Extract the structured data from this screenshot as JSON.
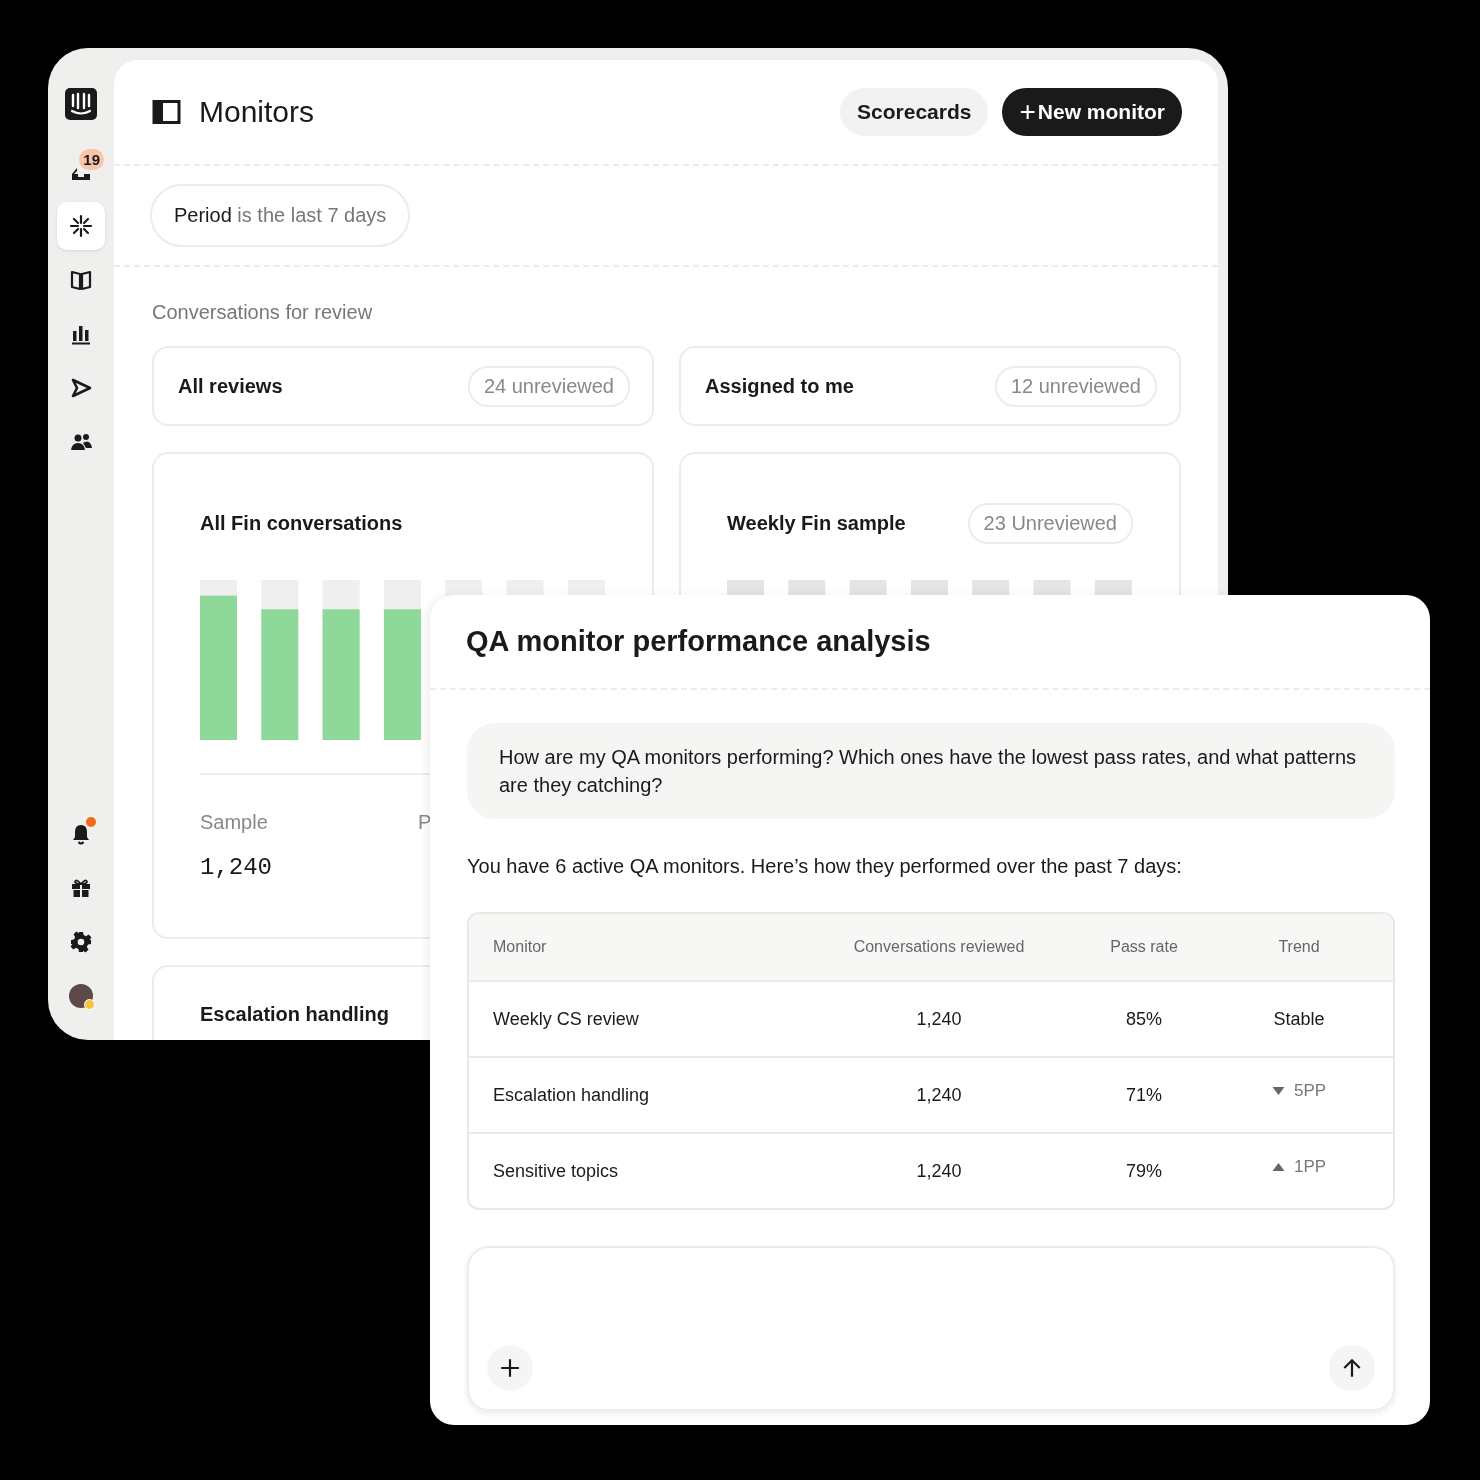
{
  "sidebar": {
    "nav_items": [
      {
        "selected": false,
        "badge": "19"
      },
      {
        "selected": true
      },
      {
        "selected": false
      },
      {
        "selected": false
      },
      {
        "selected": false
      },
      {
        "selected": false
      }
    ],
    "bottom_items": [
      {
        "notify": true
      },
      {
        "notify": false
      },
      {
        "notify": false
      }
    ]
  },
  "header": {
    "title": "Monitors",
    "buttons": [
      {
        "label": "Scorecards",
        "kind": "secondary"
      },
      {
        "label": "New monitor",
        "kind": "primary",
        "icon": "+"
      }
    ]
  },
  "filter": {
    "field": "Period",
    "condition": "is the last 7 days"
  },
  "section_label": "Conversations for review",
  "review_cards": [
    {
      "title": "All reviews",
      "count": "24 unreviewed"
    },
    {
      "title": "Assigned to me",
      "count": "12 unreviewed"
    }
  ],
  "monitor_cards": [
    {
      "title": "All Fin conversations",
      "stats": [
        {
          "label": "Sample",
          "value": "1,240"
        },
        {
          "label": "P"
        }
      ]
    },
    {
      "title": "Weekly Fin sample",
      "count": "23 Unreviewed"
    },
    {
      "title": "Escalation handling"
    }
  ],
  "dialog": {
    "title": "QA monitor performance analysis",
    "question": "How are my QA monitors performing? Which ones have the lowest pass rates, and what patterns are they catching?",
    "answer": "You have 6 active QA monitors. Here’s how they performed over the past 7 days:",
    "table": {
      "columns": [
        "Monitor",
        "Conversations reviewed",
        "Pass rate",
        "Trend"
      ],
      "rows": [
        {
          "monitor": "Weekly CS review",
          "reviewed": "1,240",
          "pass_rate": "85%",
          "trend": "Stable",
          "kind": "plain"
        },
        {
          "monitor": "Escalation handling",
          "reviewed": "1,240",
          "pass_rate": "71%",
          "trend": "5PP",
          "kind": "down"
        },
        {
          "monitor": "Sensitive topics",
          "reviewed": "1,240",
          "pass_rate": "79%",
          "trend": "1PP",
          "kind": "up"
        }
      ]
    }
  }
}
